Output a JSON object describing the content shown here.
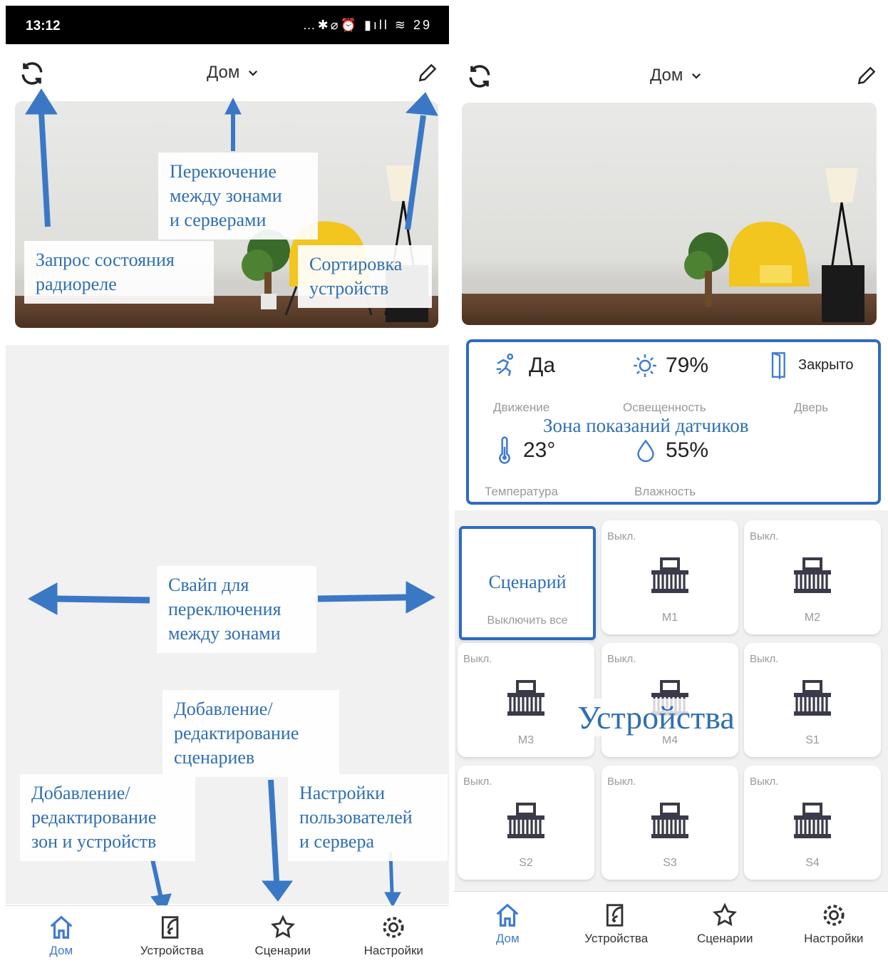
{
  "status_bar": {
    "time": "13:12",
    "icons": "…✱⌀⏰ ▮ıll ≋ 29"
  },
  "left": {
    "header": {
      "title": "Дом"
    },
    "callouts": {
      "zones": "Перекючение\nмежду зонами\nи серверами",
      "refresh": "Запрос состояния\nрадиореле",
      "sort": "Сортировка\nустройств",
      "swipe": "Свайп для\nпереключения\nмежду зонами",
      "scenarios": "Добавление/\nредактирование\nсценариев",
      "zones_devices": "Добавление/\nредактирование\nзон и устройств",
      "settings": "Настройки\nпользователей\nи сервера"
    }
  },
  "right": {
    "header": {
      "title": "Дом"
    },
    "sensors": {
      "motion": {
        "value": "Да",
        "label": "Движение"
      },
      "light": {
        "value": "79%",
        "label": "Освещенность"
      },
      "door": {
        "value": "Закрыто",
        "label": "Дверь"
      },
      "temp": {
        "value": "23°",
        "label": "Температура"
      },
      "humidity": {
        "value": "55%",
        "label": "Влажность"
      },
      "zone_label": "Зона показаний датчиков"
    },
    "scenario_tile": {
      "title": "Сценарий",
      "action": "Выключить все"
    },
    "devices": [
      {
        "state": "Выкл.",
        "name": "M1"
      },
      {
        "state": "Выкл.",
        "name": "M2"
      },
      {
        "state": "Выкл.",
        "name": "M3"
      },
      {
        "state": "Выкл.",
        "name": "M4"
      },
      {
        "state": "Выкл.",
        "name": "S1"
      },
      {
        "state": "Выкл.",
        "name": "S2"
      },
      {
        "state": "Выкл.",
        "name": "S3"
      },
      {
        "state": "Выкл.",
        "name": "S4"
      }
    ],
    "devices_label": "Устройства"
  },
  "tabs": [
    {
      "label": "Дом",
      "icon": "home-icon"
    },
    {
      "label": "Устройства",
      "icon": "devices-icon"
    },
    {
      "label": "Сценарии",
      "icon": "star-icon"
    },
    {
      "label": "Настройки",
      "icon": "gear-icon"
    }
  ],
  "colors": {
    "accent": "#3d7bd0",
    "annotation": "#2f6fb2",
    "arrow": "#3a78c6"
  }
}
